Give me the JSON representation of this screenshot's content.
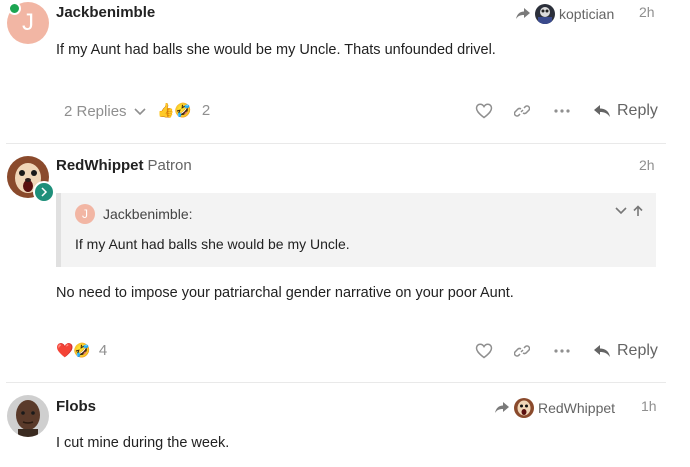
{
  "posts": [
    {
      "username": "Jackbenimble",
      "avatar_letter": "J",
      "reply_to_user": "koptician",
      "time": "2h",
      "body": "If my Aunt had balls she would be my Uncle. Thats unfounded drivel.",
      "replies_label": "2 Replies",
      "reaction_emojis": "👍🤣",
      "reaction_count": "2",
      "reply_label": "Reply"
    },
    {
      "username": "RedWhippet",
      "user_title": "Patron",
      "time": "2h",
      "quote_author": "Jackbenimble:",
      "quote_avatar_letter": "J",
      "quote_text": "If my Aunt had balls she would be my Uncle.",
      "body": "No need to impose your patriarchal gender narrative on your poor Aunt.",
      "reaction_emojis": "❤️🤣",
      "reaction_count": "4",
      "reply_label": "Reply"
    },
    {
      "username": "Flobs",
      "reply_to_user": "RedWhippet",
      "time": "1h",
      "body": "I cut mine during the week."
    }
  ],
  "colors": {
    "letter_avatar_bg": "#f2b6a4",
    "online": "#1ca551",
    "heart": "#e0245e"
  },
  "icons": [
    "share-arrow-icon",
    "chevron-down-icon",
    "heart-icon",
    "link-icon",
    "more-icon",
    "reply-arrow-icon",
    "chevron-up-icon"
  ]
}
